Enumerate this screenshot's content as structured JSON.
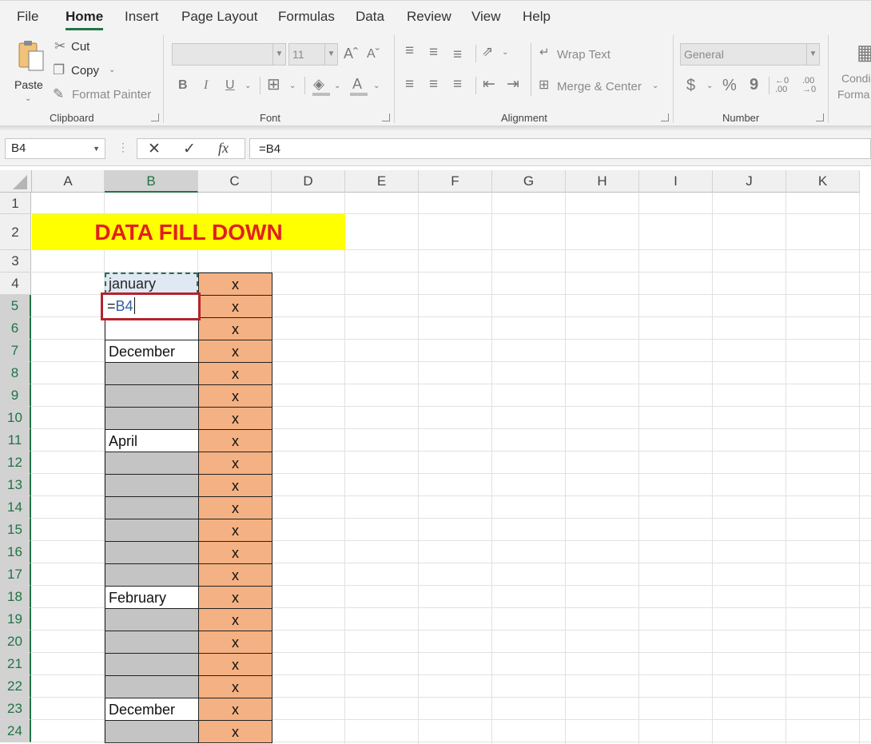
{
  "menu": {
    "tabs": [
      "File",
      "Home",
      "Insert",
      "Page Layout",
      "Formulas",
      "Data",
      "Review",
      "View",
      "Help"
    ],
    "active_tab": "Home"
  },
  "ribbon": {
    "clipboard": {
      "paste": "Paste",
      "cut": "Cut",
      "copy": "Copy",
      "format_painter": "Format Painter",
      "group": "Clipboard"
    },
    "font": {
      "size": "11",
      "group": "Font"
    },
    "alignment": {
      "wrap_text": "Wrap Text",
      "merge_center": "Merge & Center",
      "group": "Alignment"
    },
    "number": {
      "format": "General",
      "group": "Number",
      "percent": "%",
      "comma": "9"
    },
    "styles": {
      "cond_line1": "Condi",
      "cond_line2": "Forma"
    }
  },
  "formula_bar": {
    "name_box": "B4",
    "formula": "=B4",
    "fx": "fx"
  },
  "sheet": {
    "columns": [
      "A",
      "B",
      "C",
      "D",
      "E",
      "F",
      "G",
      "H",
      "I",
      "J",
      "K"
    ],
    "rows": [
      "1",
      "2",
      "3",
      "4",
      "5",
      "6",
      "7",
      "8",
      "9",
      "10",
      "11",
      "12",
      "13",
      "14",
      "15",
      "16",
      "17",
      "18",
      "19",
      "20",
      "21",
      "22",
      "23",
      "24"
    ],
    "title": "DATA FILL DOWN",
    "b4": "january",
    "b5_formula_prefix": "=",
    "b5_formula_ref": "B4",
    "b7": "December",
    "b11": "April",
    "b18": "February",
    "b23": "December",
    "c_marker": "x"
  }
}
